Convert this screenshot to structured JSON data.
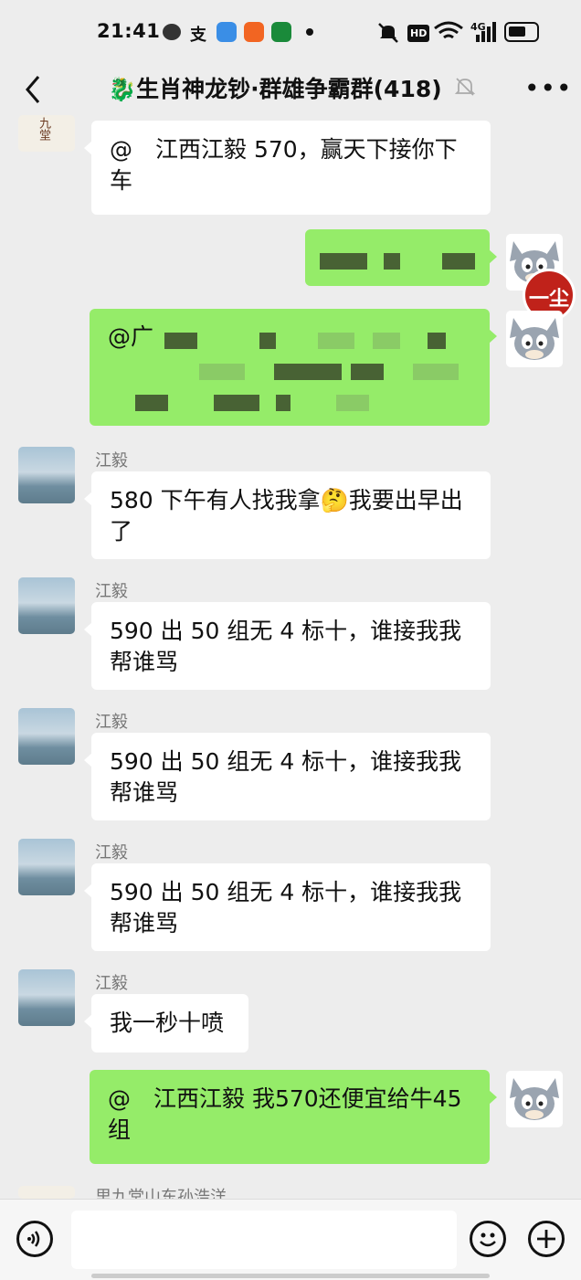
{
  "status": {
    "time": "21:41",
    "net": "4G",
    "hd": "HD"
  },
  "header": {
    "title": "🐉生肖神龙钞·群雄争霸群(418)"
  },
  "messages": [
    {
      "id": 1,
      "side": "left",
      "text": "@　江西江毅 570，赢天下接你下车"
    },
    {
      "id": 2,
      "side": "right",
      "redacted": true
    },
    {
      "id": 3,
      "side": "right",
      "text": "@广",
      "redacted": true
    },
    {
      "id": 4,
      "side": "left",
      "sender": "江毅",
      "text": "580 下午有人找我拿🤔我要出早出了"
    },
    {
      "id": 5,
      "side": "left",
      "sender": "江毅",
      "text": "590 出 50 组无 4 标十，谁接我我帮谁骂"
    },
    {
      "id": 6,
      "side": "left",
      "sender": "江毅",
      "text": "590 出 50 组无 4 标十，谁接我我帮谁骂"
    },
    {
      "id": 7,
      "side": "left",
      "sender": "江毅",
      "text": "590 出 50 组无 4 标十，谁接我我帮谁骂"
    },
    {
      "id": 8,
      "side": "left",
      "sender": "江毅",
      "text": "我一秒十喷"
    },
    {
      "id": 9,
      "side": "right",
      "text": "@　江西江毅 我570还便宜给牛45组"
    }
  ],
  "partial_sender": "里九堂山东孙浩洋",
  "avatar_badge": "一尘",
  "top_avatar_text": "九堂",
  "input": {
    "placeholder": ""
  },
  "icons": {
    "back": "chevron-left-icon",
    "mute": "bell-off-icon",
    "more": "more-dots-icon",
    "voice": "voice-icon",
    "emoji": "emoji-icon",
    "add": "plus-icon"
  }
}
